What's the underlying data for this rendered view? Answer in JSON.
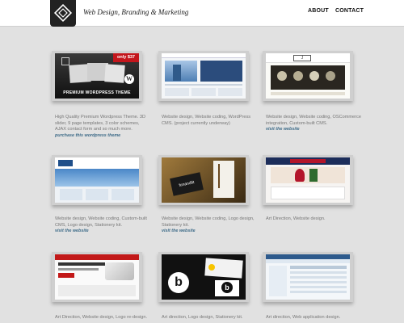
{
  "header": {
    "tagline": "Web Design, Branding & Marketing",
    "nav": {
      "about": "ABOUT",
      "contact": "CONTACT"
    }
  },
  "thumbs": {
    "promo_price": "only $37",
    "promo_title": "PREMIUM WORDPRESS THEME",
    "thumb_brand": "funandfit"
  },
  "portfolio": [
    {
      "desc": "High Quality Premium Wordpress Theme. 3D slider, 9 page templates, 3 color schemes, AJAX contact form and so much more.",
      "link": "purchase this wordpress theme"
    },
    {
      "desc": "Website design, Website coding, WordPress CMS. (project currently underway)",
      "link": ""
    },
    {
      "desc": "Website design, Website coding, OSCommerce integration, Custom-built CMS.",
      "link": "visit the website"
    },
    {
      "desc": "Website design, Website coding, Custom-built CMS, Logo design, Stationery kit.",
      "link": "visit the website"
    },
    {
      "desc": "Website design, Website coding, Logo design, Stationery kit.",
      "link": "visit the website"
    },
    {
      "desc": "Art Direction, Website design.",
      "link": ""
    },
    {
      "desc": "Art Direction, Website design, Logo re-design.",
      "link": ""
    },
    {
      "desc": "Art direction, Logo design, Stationery kit.",
      "link": ""
    },
    {
      "desc": "Art direction, Web application design.",
      "link": ""
    }
  ],
  "colors": {
    "background": "#e1e1e1",
    "link": "#3d6b88",
    "logo": "#222222"
  }
}
